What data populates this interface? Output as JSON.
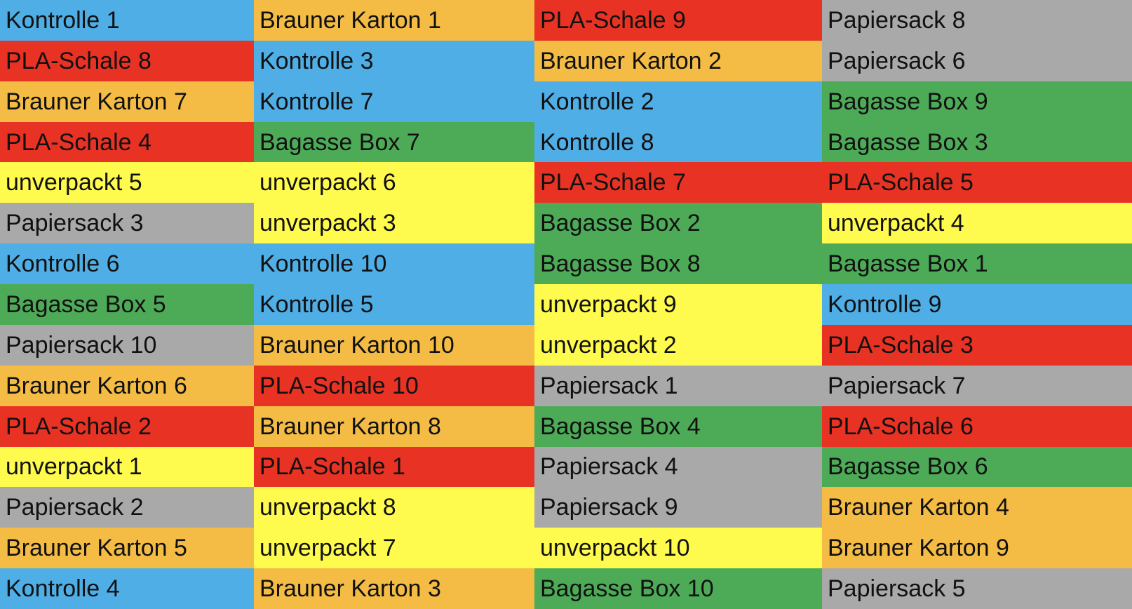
{
  "colors": {
    "blue": "#4faee6",
    "orange": "#f4bc45",
    "red": "#e83324",
    "gray": "#a9a9a9",
    "green": "#4dab58",
    "yellow": "#fffb4e"
  },
  "rows": [
    [
      {
        "label": "Kontrolle 1",
        "color": "blue"
      },
      {
        "label": "Brauner Karton 1",
        "color": "orange"
      },
      {
        "label": "PLA-Schale 9",
        "color": "red"
      },
      {
        "label": "Papiersack 8",
        "color": "gray"
      }
    ],
    [
      {
        "label": "PLA-Schale 8",
        "color": "red"
      },
      {
        "label": "Kontrolle 3",
        "color": "blue"
      },
      {
        "label": "Brauner Karton 2",
        "color": "orange"
      },
      {
        "label": "Papiersack 6",
        "color": "gray"
      }
    ],
    [
      {
        "label": "Brauner Karton 7",
        "color": "orange"
      },
      {
        "label": "Kontrolle 7",
        "color": "blue"
      },
      {
        "label": "Kontrolle 2",
        "color": "blue"
      },
      {
        "label": "Bagasse Box 9",
        "color": "green"
      }
    ],
    [
      {
        "label": "PLA-Schale 4",
        "color": "red"
      },
      {
        "label": "Bagasse Box 7",
        "color": "green"
      },
      {
        "label": "Kontrolle 8",
        "color": "blue"
      },
      {
        "label": "Bagasse Box 3",
        "color": "green"
      }
    ],
    [
      {
        "label": "unverpackt 5",
        "color": "yellow"
      },
      {
        "label": "unverpackt 6",
        "color": "yellow"
      },
      {
        "label": "PLA-Schale 7",
        "color": "red"
      },
      {
        "label": "PLA-Schale 5",
        "color": "red"
      }
    ],
    [
      {
        "label": "Papiersack 3",
        "color": "gray"
      },
      {
        "label": "unverpackt 3",
        "color": "yellow"
      },
      {
        "label": "Bagasse Box 2",
        "color": "green"
      },
      {
        "label": "unverpackt 4",
        "color": "yellow"
      }
    ],
    [
      {
        "label": "Kontrolle 6",
        "color": "blue"
      },
      {
        "label": "Kontrolle 10",
        "color": "blue"
      },
      {
        "label": "Bagasse Box 8",
        "color": "green"
      },
      {
        "label": "Bagasse Box 1",
        "color": "green"
      }
    ],
    [
      {
        "label": "Bagasse Box 5",
        "color": "green"
      },
      {
        "label": "Kontrolle 5",
        "color": "blue"
      },
      {
        "label": "unverpackt 9",
        "color": "yellow"
      },
      {
        "label": "Kontrolle 9",
        "color": "blue"
      }
    ],
    [
      {
        "label": "Papiersack 10",
        "color": "gray"
      },
      {
        "label": "Brauner Karton 10",
        "color": "orange"
      },
      {
        "label": "unverpackt 2",
        "color": "yellow"
      },
      {
        "label": "PLA-Schale 3",
        "color": "red"
      }
    ],
    [
      {
        "label": "Brauner Karton 6",
        "color": "orange"
      },
      {
        "label": "PLA-Schale 10",
        "color": "red"
      },
      {
        "label": "Papiersack 1",
        "color": "gray"
      },
      {
        "label": "Papiersack 7",
        "color": "gray"
      }
    ],
    [
      {
        "label": "PLA-Schale 2",
        "color": "red"
      },
      {
        "label": "Brauner Karton 8",
        "color": "orange"
      },
      {
        "label": "Bagasse Box 4",
        "color": "green"
      },
      {
        "label": "PLA-Schale 6",
        "color": "red"
      }
    ],
    [
      {
        "label": "unverpackt 1",
        "color": "yellow"
      },
      {
        "label": "PLA-Schale 1",
        "color": "red"
      },
      {
        "label": "Papiersack 4",
        "color": "gray"
      },
      {
        "label": "Bagasse Box 6",
        "color": "green"
      }
    ],
    [
      {
        "label": "Papiersack 2",
        "color": "gray"
      },
      {
        "label": "unverpackt 8",
        "color": "yellow"
      },
      {
        "label": "Papiersack 9",
        "color": "gray"
      },
      {
        "label": "Brauner Karton 4",
        "color": "orange"
      }
    ],
    [
      {
        "label": "Brauner Karton 5",
        "color": "orange"
      },
      {
        "label": "unverpackt 7",
        "color": "yellow"
      },
      {
        "label": "unverpackt 10",
        "color": "yellow"
      },
      {
        "label": "Brauner Karton 9",
        "color": "orange"
      }
    ],
    [
      {
        "label": "Kontrolle 4",
        "color": "blue"
      },
      {
        "label": "Brauner Karton 3",
        "color": "orange"
      },
      {
        "label": "Bagasse Box 10",
        "color": "green"
      },
      {
        "label": "Papiersack 5",
        "color": "gray"
      }
    ]
  ]
}
